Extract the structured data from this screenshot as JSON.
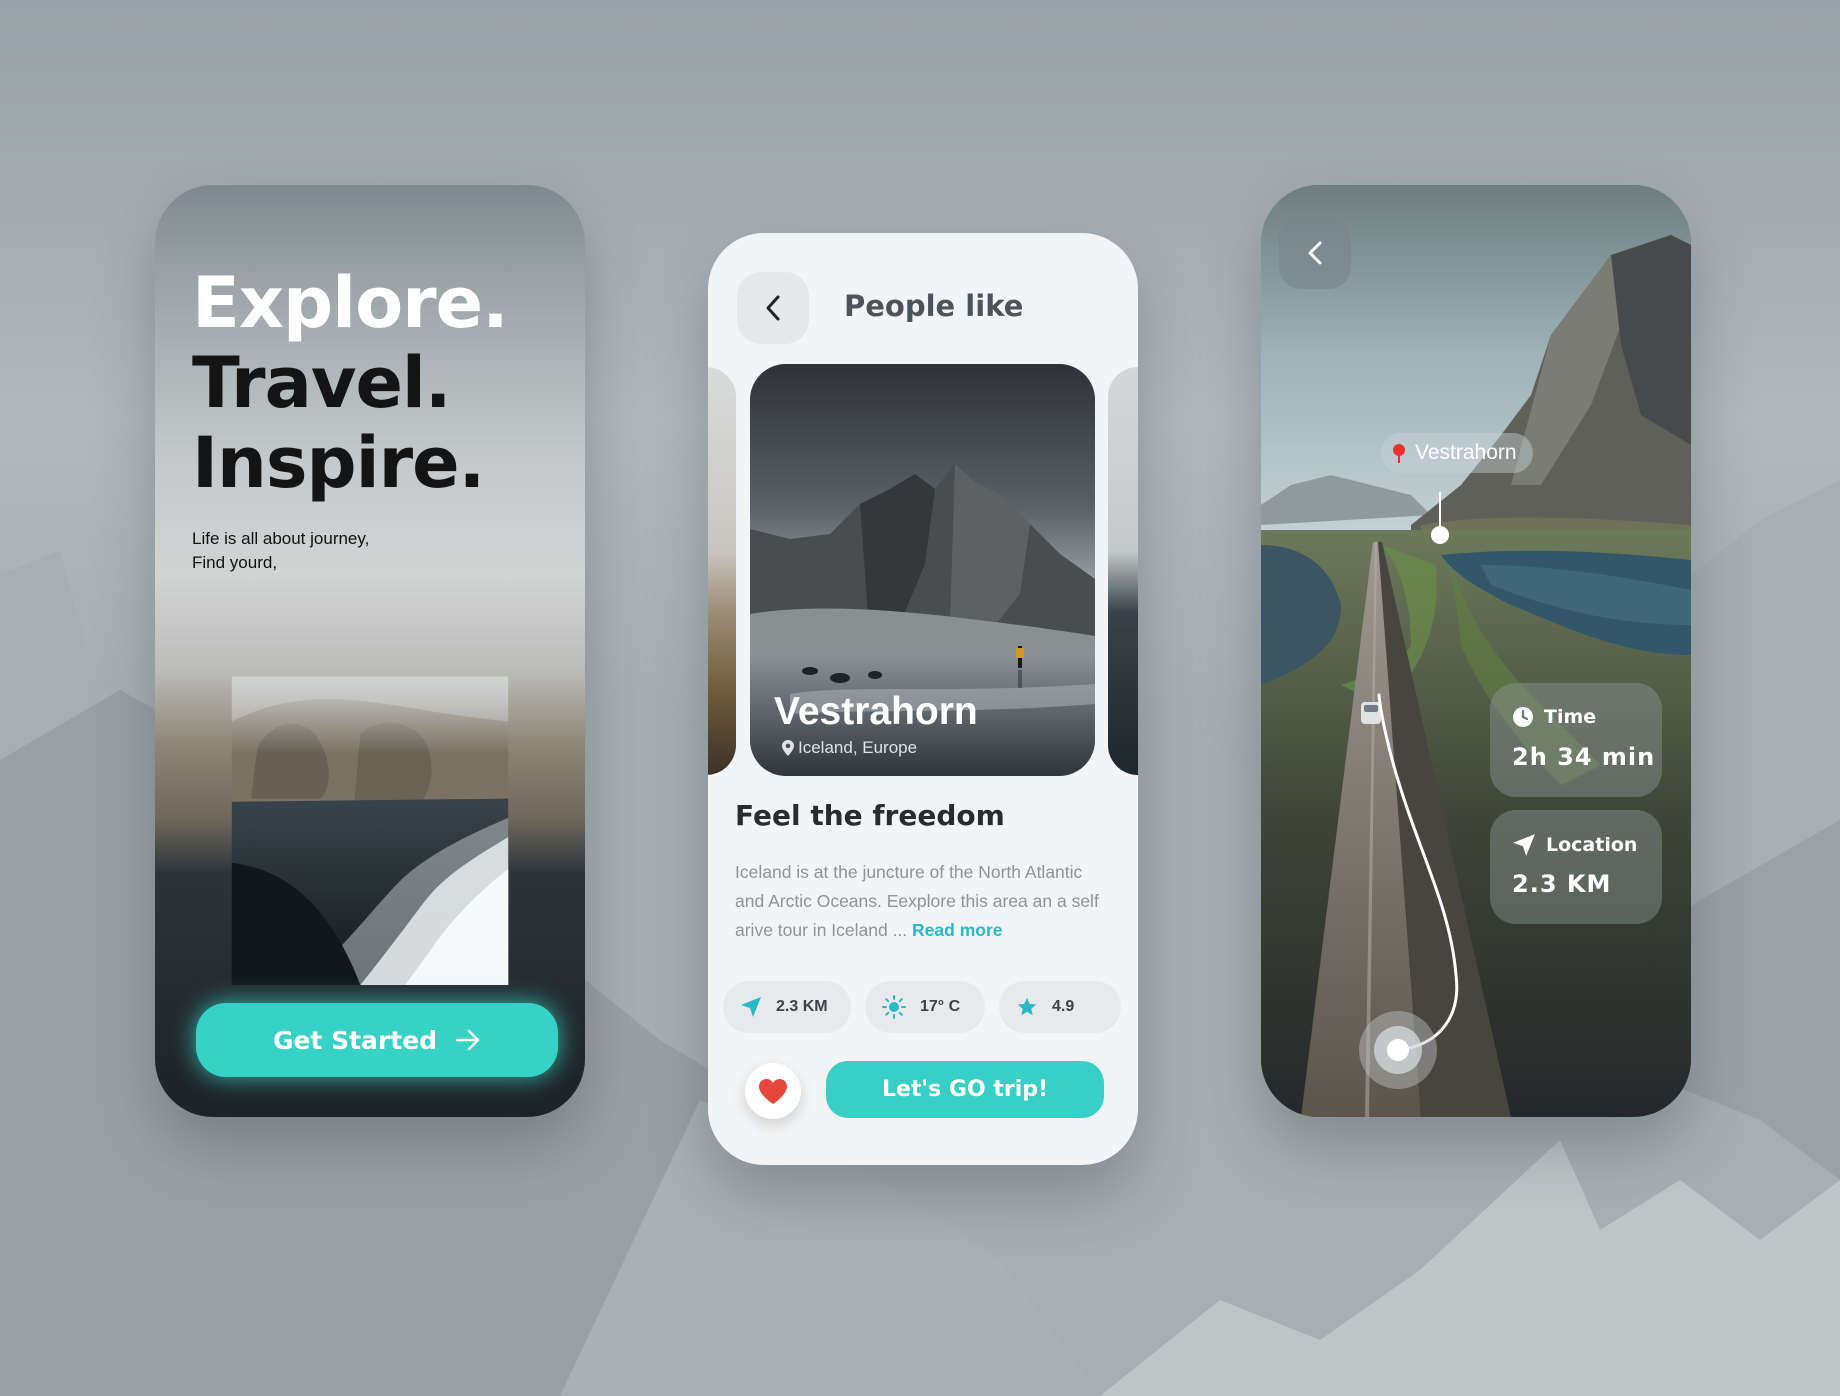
{
  "colors": {
    "accent": "#37d2c6",
    "link": "#2ab7c7",
    "background": "#9aa3a8",
    "heart": "#e8453c"
  },
  "screen1": {
    "headline": [
      "Explore.",
      "Travel.",
      "Inspire."
    ],
    "subtitle": [
      "Life is all about journey,",
      "Find yourd,"
    ],
    "cta_label": "Get Started",
    "cta_icon": "arrow-right-icon"
  },
  "screen2": {
    "title": "People like",
    "back_icon": "chevron-left-icon",
    "card": {
      "name": "Vestrahorn",
      "location": "Iceland, Europe",
      "location_icon": "map-pin-icon"
    },
    "heading": "Feel the freedom",
    "description": [
      "Iceland is at the juncture of the North Atlantic",
      "and Arctic Oceans. Eexplore this area an a self",
      "arive tour in Iceland ... "
    ],
    "read_more": "Read more",
    "chips": [
      {
        "icon": "navigation-arrow-icon",
        "label": "2.3 KM"
      },
      {
        "icon": "sun-icon",
        "label": "17° C"
      },
      {
        "icon": "star-icon",
        "label": "4.9"
      }
    ],
    "favorite_icon": "heart-icon",
    "go_label": "Let's GO trip!"
  },
  "screen3": {
    "back_icon": "chevron-left-icon",
    "pin_label": "Vestrahorn",
    "pin_icon": "map-pin-icon",
    "time": {
      "label": "Time",
      "value": "2h 34 min",
      "icon": "clock-icon"
    },
    "location": {
      "label": "Location",
      "value": "2.3 KM",
      "icon": "navigation-arrow-icon"
    }
  }
}
